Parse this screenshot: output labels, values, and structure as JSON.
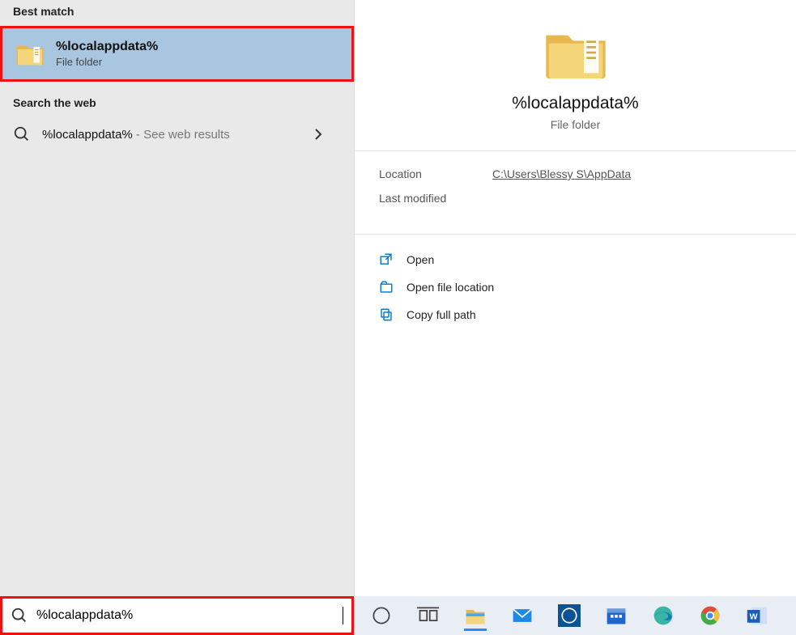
{
  "left": {
    "best_match_header": "Best match",
    "best_match_title": "%localappdata%",
    "best_match_sub": "File folder",
    "web_header": "Search the web",
    "web_text": "%localappdata%",
    "web_suffix": " - See web results"
  },
  "right": {
    "title": "%localappdata%",
    "sub": "File folder",
    "location_label": "Location",
    "location_value": "C:\\Users\\Blessy S\\AppData",
    "modified_label": "Last modified",
    "actions": {
      "open": "Open",
      "open_loc": "Open file location",
      "copy_path": "Copy full path"
    }
  },
  "search_value": "%localappdata%"
}
